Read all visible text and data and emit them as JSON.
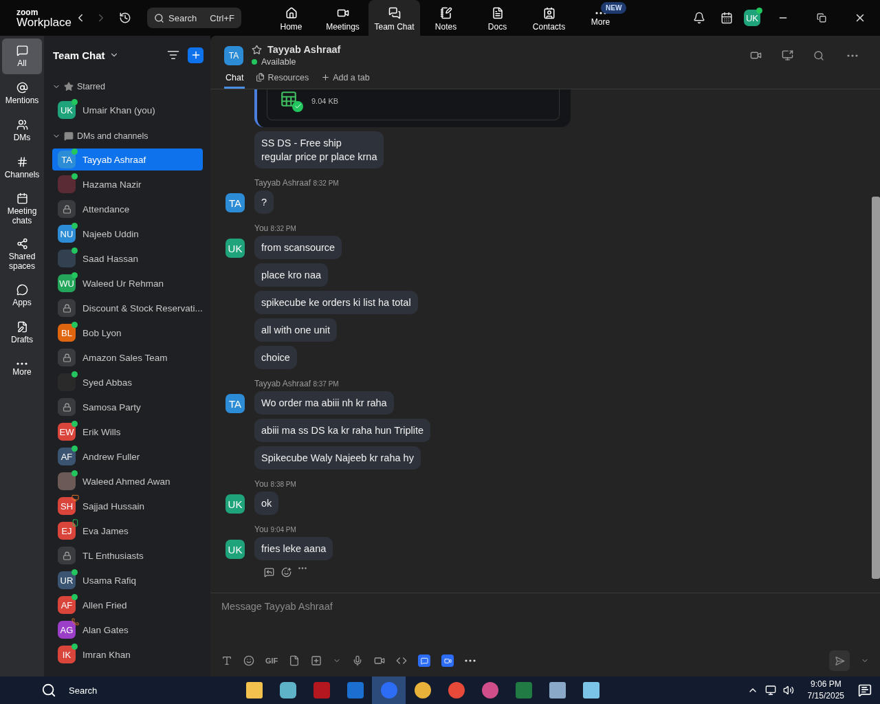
{
  "app": {
    "logo_top": "zoom",
    "logo_bottom": "Workplace"
  },
  "search": {
    "placeholder": "Search",
    "shortcut": "Ctrl+F"
  },
  "nav_tabs": [
    {
      "kind": "home",
      "label": "Home",
      "selected": false
    },
    {
      "kind": "meetings",
      "label": "Meetings",
      "selected": false
    },
    {
      "kind": "chat",
      "label": "Team Chat",
      "selected": true
    },
    {
      "kind": "notes",
      "label": "Notes",
      "selected": false
    },
    {
      "kind": "docs",
      "label": "Docs",
      "selected": false
    },
    {
      "kind": "contacts",
      "label": "Contacts",
      "selected": false
    },
    {
      "kind": "more",
      "label": "More",
      "selected": false,
      "badge": "NEW"
    }
  ],
  "profile": {
    "initials": "UK"
  },
  "rail": [
    {
      "kind": "all",
      "label": "All",
      "selected": true
    },
    {
      "kind": "mentions",
      "label": "Mentions",
      "selected": false
    },
    {
      "kind": "dms",
      "label": "DMs",
      "selected": false
    },
    {
      "kind": "channels",
      "label": "Channels",
      "selected": false
    },
    {
      "kind": "meeting",
      "label": "Meeting chats",
      "selected": false
    },
    {
      "kind": "shared",
      "label": "Shared spaces",
      "selected": false
    },
    {
      "kind": "apps",
      "label": "Apps",
      "selected": false
    },
    {
      "kind": "drafts",
      "label": "Drafts",
      "selected": false
    },
    {
      "kind": "more",
      "label": "More",
      "selected": false
    }
  ],
  "sidebar": {
    "title": "Team Chat",
    "sections": [
      {
        "kind": "starred",
        "title": "Starred",
        "expanded": true,
        "items": [
          {
            "kind": "person",
            "initials": "UK",
            "color": "#1fa37a",
            "name": "Umair Khan (you)",
            "online": true,
            "selected": false
          }
        ]
      },
      {
        "kind": "dms",
        "title": "DMs and channels",
        "expanded": true,
        "items": [
          {
            "kind": "person",
            "initials": "TA",
            "color": "#2d8cd6",
            "name": "Tayyab Ashraaf",
            "online": true,
            "selected": true
          },
          {
            "kind": "photo",
            "color": "#5a2a35",
            "name": "Hazama Nazir",
            "online": true,
            "selected": false
          },
          {
            "kind": "channel",
            "color": "#3a3b3e",
            "name": "Attendance",
            "selected": false
          },
          {
            "kind": "person",
            "initials": "NU",
            "color": "#2d8cd6",
            "name": "Najeeb Uddin",
            "online": true,
            "selected": false
          },
          {
            "kind": "photo",
            "color": "#33404f",
            "name": "Saad Hassan",
            "online": true,
            "selected": false
          },
          {
            "kind": "person",
            "initials": "WU",
            "color": "#23a55a",
            "name": "Waleed Ur Rehman",
            "online": true,
            "selected": false
          },
          {
            "kind": "channel",
            "color": "#3a3b3e",
            "name": "Discount & Stock Reservati...",
            "selected": false
          },
          {
            "kind": "person",
            "initials": "BL",
            "color": "#e0650f",
            "name": "Bob Lyon",
            "online": true,
            "selected": false
          },
          {
            "kind": "channel",
            "color": "#3a3b3e",
            "name": "Amazon Sales Team",
            "selected": false
          },
          {
            "kind": "photo",
            "color": "#2a2a2a",
            "name": "Syed Abbas",
            "online": true,
            "selected": false
          },
          {
            "kind": "channel",
            "color": "#3a3b3e",
            "name": "Samosa Party",
            "selected": false
          },
          {
            "kind": "person",
            "initials": "EW",
            "color": "#d9453b",
            "name": "Erik Wills",
            "online": true,
            "selected": false
          },
          {
            "kind": "person",
            "initials": "AF",
            "color": "#3b5471",
            "name": "Andrew Fuller",
            "online": true,
            "selected": false
          },
          {
            "kind": "photo",
            "color": "#6b5a55",
            "name": "Waleed Ahmed Awan",
            "online": true,
            "selected": false
          },
          {
            "kind": "person",
            "initials": "SH",
            "color": "#d9453b",
            "name": "Sajjad Hussain",
            "presenting": true,
            "selected": false
          },
          {
            "kind": "person",
            "initials": "EJ",
            "color": "#d9453b",
            "name": "Eva James",
            "on_mobile": true,
            "selected": false
          },
          {
            "kind": "channel",
            "color": "#3a3b3e",
            "name": "TL Enthusiasts",
            "selected": false
          },
          {
            "kind": "person",
            "initials": "UR",
            "color": "#3b5471",
            "name": "Usama Rafiq",
            "online": true,
            "selected": false
          },
          {
            "kind": "person",
            "initials": "AF",
            "color": "#d9453b",
            "name": "Allen Fried",
            "online": true,
            "selected": false
          },
          {
            "kind": "person",
            "initials": "AG",
            "color": "#9b3fc9",
            "name": "Alan Gates",
            "on_call": true,
            "selected": false
          },
          {
            "kind": "person",
            "initials": "IK",
            "color": "#d9453b",
            "name": "Imran Khan",
            "online": true,
            "selected": false
          }
        ]
      }
    ]
  },
  "chat": {
    "initials": "TA",
    "name": "Tayyab Ashraaf",
    "status": "Available",
    "tabs": [
      {
        "kind": "chat",
        "label": "Chat",
        "selected": true
      },
      {
        "kind": "resources",
        "label": "Resources",
        "selected": false
      },
      {
        "kind": "add",
        "label": "Add a tab",
        "selected": false
      }
    ],
    "attachment": {
      "size": "9.04 KB"
    },
    "groups": [
      {
        "bubbles": [
          "SS DS - Free ship\nregular price pr place krna"
        ]
      },
      {
        "initials": "TA",
        "color": "#2d8cd6",
        "sender": "Tayyab Ashraaf",
        "time": "8:32 PM",
        "bubbles": [
          "?"
        ]
      },
      {
        "initials": "UK",
        "color": "#1fa37a",
        "sender": "You",
        "time": "8:32 PM",
        "bubbles": [
          "from scansource",
          "place kro naa",
          "spikecube ke orders ki list ha total",
          "all with one unit",
          "choice"
        ]
      },
      {
        "initials": "TA",
        "color": "#2d8cd6",
        "sender": "Tayyab Ashraaf",
        "time": "8:37 PM",
        "bubbles": [
          "Wo order ma abiii nh kr raha",
          "abiii ma ss DS ka kr raha hun Triplite",
          "Spikecube Waly Najeeb kr raha hy"
        ]
      },
      {
        "initials": "UK",
        "color": "#1fa37a",
        "sender": "You",
        "time": "8:38 PM",
        "bubbles": [
          "ok"
        ]
      },
      {
        "initials": "UK",
        "color": "#1fa37a",
        "sender": "You",
        "time": "9:04 PM",
        "bubbles": [
          "fries leke aana"
        ]
      }
    ],
    "composer": {
      "placeholder": "Message Tayyab Ashraaf",
      "gif": "GIF"
    }
  },
  "taskbar": {
    "search": "Search",
    "time": "9:06 PM",
    "date": "7/15/2025"
  }
}
